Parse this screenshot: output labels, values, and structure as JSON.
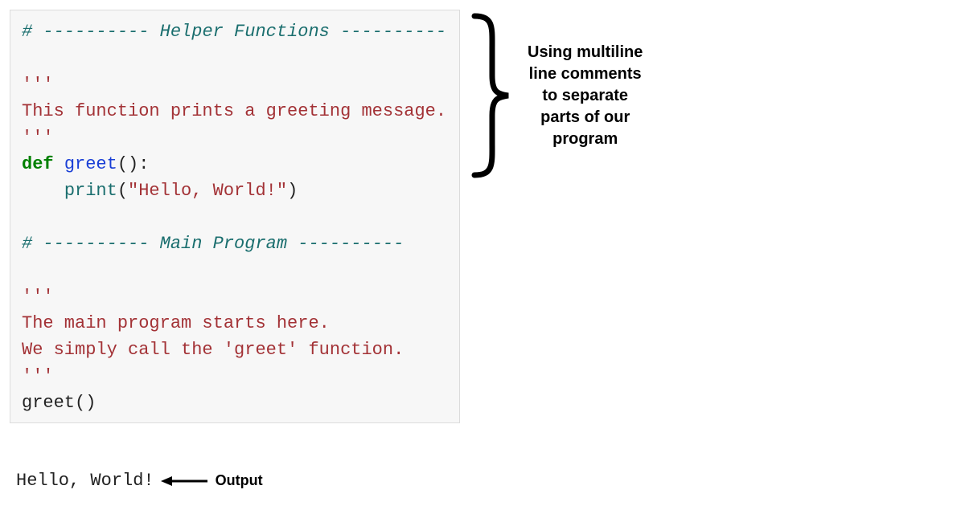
{
  "code": {
    "section1_hash": "#",
    "section1_dashes_left": " ---------- ",
    "section1_title": "Helper Functions",
    "section1_dashes_right": " ----------",
    "doc1_open": "'''",
    "doc1_body": "This function prints a greeting message.",
    "doc1_close": "'''",
    "def_kw": "def",
    "space1": " ",
    "func_name": "greet",
    "def_tail": "():",
    "indent": "    ",
    "print_name": "print",
    "print_open": "(",
    "print_arg": "\"Hello, World!\"",
    "print_close": ")",
    "section2_hash": "#",
    "section2_dashes_left": " ---------- ",
    "section2_title": "Main Program",
    "section2_dashes_right": " ----------",
    "doc2_open": "'''",
    "doc2_line1": "The main program starts here.",
    "doc2_line2": "We simply call the 'greet' function.",
    "doc2_close": "'''",
    "call_name": "greet",
    "call_tail": "()"
  },
  "output": {
    "text": "Hello, World!",
    "label": "Output"
  },
  "annotation": {
    "line1": "Using multiline",
    "line2": "line comments",
    "line3": "to separate",
    "line4": "parts of our",
    "line5": "program"
  }
}
